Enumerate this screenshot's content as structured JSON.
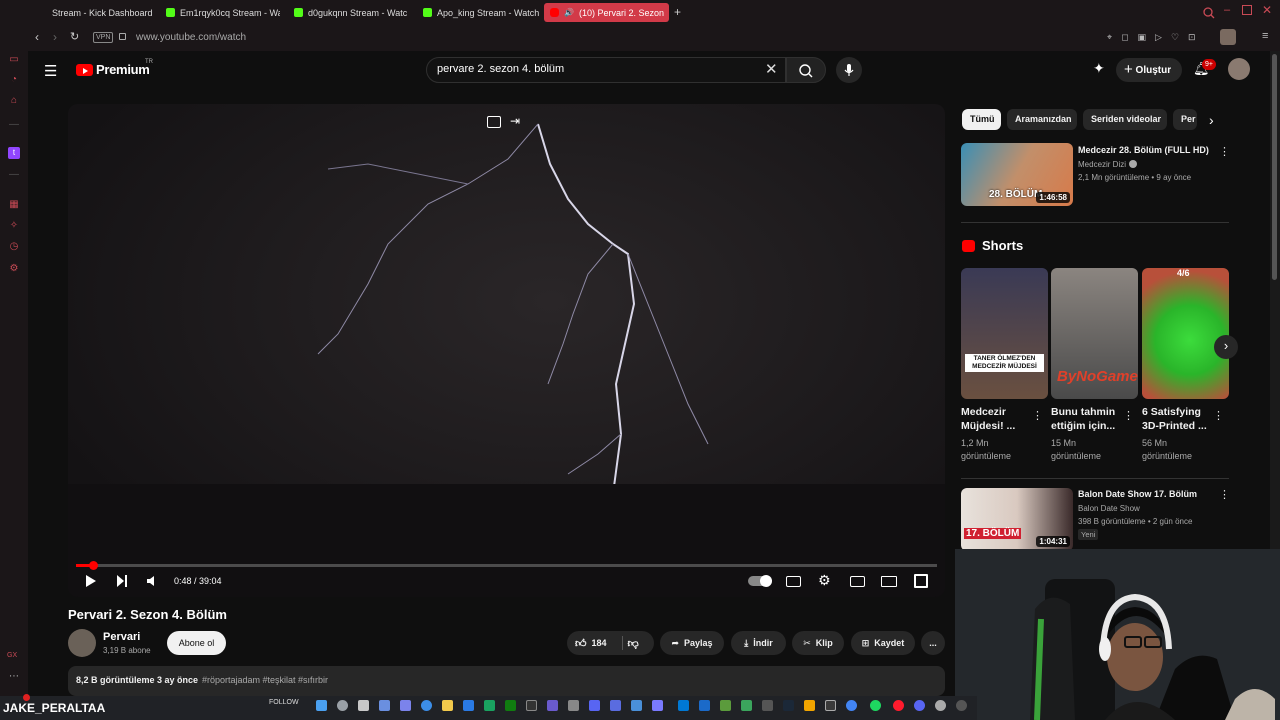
{
  "browser": {
    "tabs": [
      {
        "label": "Stream - Kick Dashboard",
        "color": "#53fc18"
      },
      {
        "label": "Em1rqyk0cq Stream - Wa",
        "color": "#53fc18"
      },
      {
        "label": "d0gukqnn Stream - Watc",
        "color": "#53fc18"
      },
      {
        "label": "Apo_king Stream - Watch",
        "color": "#53fc18"
      },
      {
        "label": "(10) Pervari 2. Sezon",
        "color": "#ff0000"
      }
    ],
    "new_tab": "+",
    "vpn": "VPN",
    "url": "www.youtube.com/watch"
  },
  "youtube": {
    "logo": "Premium",
    "region": "TR",
    "search_value": "pervare 2. sezon 4. bölüm",
    "create_label": "Oluştur",
    "notif_badge": "9+"
  },
  "player": {
    "time": "0:48 / 39:04",
    "progress_fraction": 0.02
  },
  "video": {
    "title": "Pervari 2. Sezon 4. Bölüm",
    "channel": "Pervari",
    "subs": "3,19 B abone",
    "subscribe": "Abone ol",
    "likes": "184",
    "share": "Paylaş",
    "download": "İndir",
    "clip": "Klip",
    "save": "Kaydet",
    "more": "...",
    "desc_stats": "8,2 B görüntüleme  3 ay önce",
    "desc_tags": "#röportajadam #teşkilat #sıfırbir"
  },
  "sidebar": {
    "chips": [
      "Tümü",
      "Aramanızdan",
      "Seriden videolar",
      "Per"
    ],
    "rec1": {
      "title": "Medcezir 28. Bölüm (FULL HD)",
      "channel": "Medcezir Dizi",
      "meta": "2,1 Mn görüntüleme • 9 ay önce",
      "duration": "1:46:58",
      "thumb_text": "28. BÖLÜM"
    },
    "shorts_label": "Shorts",
    "shorts": [
      {
        "title": "Medcezir Müjdesi! ...",
        "views": "1,2 Mn görüntüleme",
        "caption": "TANER ÖLMEZ'DEN MEDCEZİR MÜJDESİ"
      },
      {
        "title": "Bunu tahmin ettiğim için...",
        "views": "15 Mn görüntüleme",
        "caption": "ByNoGame"
      },
      {
        "title": "6 Satisfying 3D-Printed ...",
        "views": "56 Mn görüntüleme",
        "caption": "4/6"
      }
    ],
    "rec2": {
      "title": "Balon Date Show 17. Bölüm",
      "channel": "Balon Date Show",
      "meta": "398 B görüntüleme • 2 gün önce",
      "badge": "Yeni",
      "duration": "1:04:31",
      "thumb_text": "17. BÖLÜM"
    }
  },
  "stream": {
    "handle": "JAKE_PERALTAA",
    "follow": "FOLLOW",
    "gx": "GX"
  }
}
